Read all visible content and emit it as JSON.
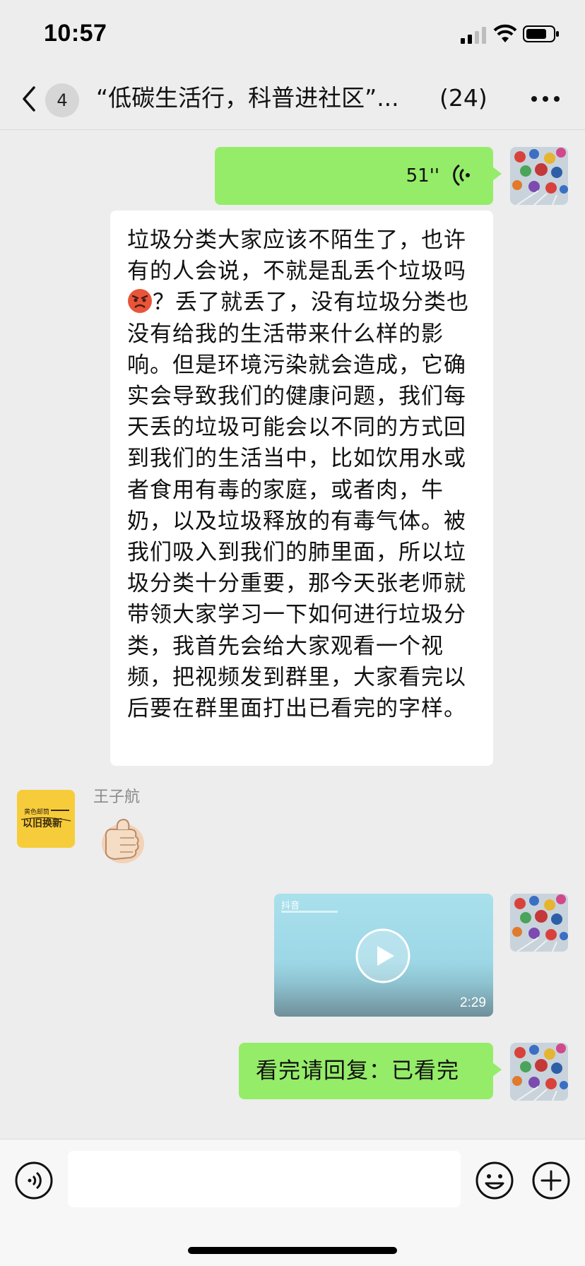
{
  "status_bar": {
    "time": "10:57"
  },
  "nav": {
    "unread_count": "4",
    "title": "“低碳生活行，科普进社区”...",
    "member_count": "(24)"
  },
  "messages": {
    "voice": {
      "duration": "51''"
    },
    "long_text_before_emoji": "垃圾分类大家应该不陌生了，也许有的人会说，不就是乱丢个垃圾吗",
    "long_text_after_emoji": "？丢了就丢了，没有垃圾分类也没有给我的生活带来什么样的影响。但是环境污染就会造成，它确实会导致我们的健康问题，我们每天丢的垃圾可能会以不同的方式回到我们的生活当中，比如饮用水或者食用有毒的家庭，或者肉，牛奶，以及垃圾释放的有毒气体。被我们吸入到我们的肺里面，所以垃圾分类十分重要，那今天张老师就带领大家学习一下如何进行垃圾分类，我首先会给大家观看一个视频，把视频发到群里，大家看完以后要在群里面打出已看完的字样。",
    "sender_name": "王子航",
    "sender_avatar_text": {
      "line1": "黄色邮筒",
      "line2": "以旧换新"
    },
    "video": {
      "brand": "抖音",
      "duration": "2:29"
    },
    "reply": "看完请回复：已看完"
  },
  "input_bar": {
    "placeholder": ""
  },
  "colors": {
    "background": "#ededed",
    "bubble_green": "#95ec69",
    "bubble_white": "#ffffff",
    "sender_avatar": "#f7cc3a"
  },
  "icons": {
    "back": "chevron-left-icon",
    "more": "more-dots-icon",
    "voice_playback": "voice-wave-icon",
    "inline_emoji": "angry-face-emoji",
    "sticker": "thumbs-up-sticker",
    "play": "play-icon",
    "voice_toggle": "voice-input-icon",
    "emoji": "emoji-icon",
    "plus": "plus-icon"
  }
}
